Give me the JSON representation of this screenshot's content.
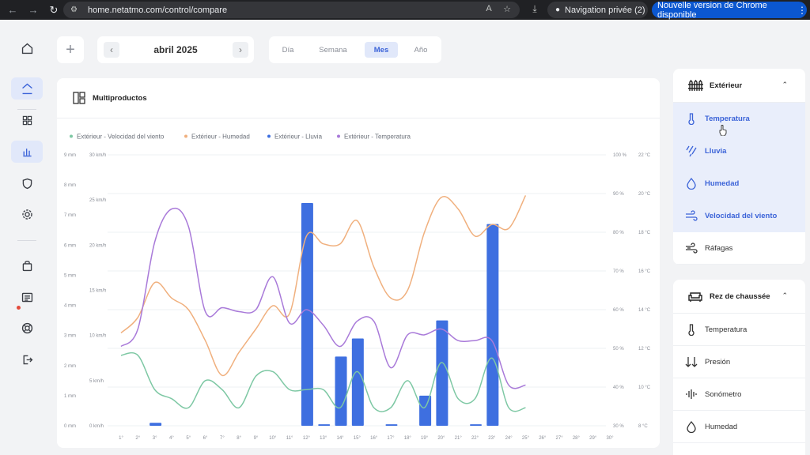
{
  "browser": {
    "url": "home.netatmo.com/control/compare",
    "private_label": "Navigation privée (2)",
    "update_label": "Nouvelle version de Chrome disponible"
  },
  "toolbar": {
    "add_label": "+",
    "month_label": "abril 2025",
    "periods": [
      {
        "label": "Día",
        "active": false
      },
      {
        "label": "Semana",
        "active": false
      },
      {
        "label": "Mes",
        "active": true
      },
      {
        "label": "Año",
        "active": false
      }
    ]
  },
  "card": {
    "title": "Multiproductos"
  },
  "right_panel": {
    "group1": {
      "title": "Extérieur",
      "items": [
        {
          "label": "Temperatura",
          "icon": "thermometer-icon",
          "selected": true
        },
        {
          "label": "Lluvia",
          "icon": "rain-icon",
          "selected": true
        },
        {
          "label": "Humedad",
          "icon": "droplet-icon",
          "selected": true
        },
        {
          "label": "Velocidad del viento",
          "icon": "wind-icon",
          "selected": true
        },
        {
          "label": "Ráfagas",
          "icon": "gust-icon",
          "selected": false
        }
      ]
    },
    "group2": {
      "title": "Rez de chaussée",
      "items": [
        {
          "label": "Temperatura",
          "icon": "thermometer-icon"
        },
        {
          "label": "Presión",
          "icon": "pressure-icon"
        },
        {
          "label": "Sonómetro",
          "icon": "sound-icon"
        },
        {
          "label": "Humedad",
          "icon": "droplet-icon"
        }
      ]
    }
  },
  "colors": {
    "wind": "#7ec8a4",
    "humidity": "#f0b07e",
    "rain": "#3e6fe0",
    "temperature": "#a97ad9",
    "accent": "#3b63d8"
  },
  "chart_data": {
    "type": "bar+line",
    "categories": [
      "1°",
      "2°",
      "3°",
      "4°",
      "5°",
      "6°",
      "7°",
      "8°",
      "9°",
      "10°",
      "11°",
      "12°",
      "13°",
      "14°",
      "15°",
      "16°",
      "17°",
      "18°",
      "19°",
      "20°",
      "21°",
      "22°",
      "23°",
      "24°",
      "25°",
      "26°",
      "27°",
      "28°",
      "29°",
      "30°"
    ],
    "axes": {
      "rain": {
        "unit": "mm",
        "min": 0,
        "max": 9,
        "ticks": [
          "0 mm",
          "1 mm",
          "2 mm",
          "3 mm",
          "4 mm",
          "5 mm",
          "6 mm",
          "7 mm",
          "8 mm",
          "9 mm"
        ]
      },
      "wind": {
        "unit": "km/h",
        "min": 0,
        "max": 30,
        "ticks": [
          "0 km/h",
          "5 km/h",
          "10 km/h",
          "15 km/h",
          "20 km/h",
          "25 km/h",
          "30 km/h"
        ]
      },
      "humidity": {
        "unit": "%",
        "min": 30,
        "max": 100,
        "ticks": [
          "30 %",
          "40 %",
          "50 %",
          "60 %",
          "70 %",
          "80 %",
          "90 %",
          "100 %"
        ]
      },
      "temperature": {
        "unit": "°C",
        "min": 8,
        "max": 22,
        "ticks": [
          "8 °C",
          "10 °C",
          "12 °C",
          "14 °C",
          "16 °C",
          "18 °C",
          "20 °C",
          "22 °C"
        ]
      }
    },
    "series": [
      {
        "name": "Extérieur - Velocidad del viento",
        "axis": "wind",
        "kind": "line",
        "values": [
          7.8,
          7.8,
          4,
          3,
          2,
          5,
          4,
          2,
          5.5,
          6,
          4,
          4,
          4,
          2,
          6,
          2,
          2,
          5,
          2,
          7,
          3,
          3,
          7.5,
          2,
          2
        ]
      },
      {
        "name": "Extérieur - Humedad",
        "axis": "humidity",
        "kind": "line",
        "values": [
          54,
          58,
          67,
          63,
          60,
          52,
          43,
          49,
          55,
          61,
          59,
          79,
          77,
          77,
          83,
          71,
          63,
          65,
          80,
          89,
          86,
          79,
          82,
          81,
          89.5
        ]
      },
      {
        "name": "Extérieur - Lluvia",
        "axis": "rain",
        "kind": "bar",
        "values": [
          0,
          0,
          0.1,
          0,
          0,
          0,
          0,
          0,
          0,
          0,
          0,
          7.4,
          0.05,
          2.3,
          2.9,
          0,
          0.05,
          0,
          1,
          3.5,
          0,
          0.05,
          6.7,
          0,
          0,
          0,
          0,
          0,
          0,
          0
        ]
      },
      {
        "name": "Extérieur - Temperatura",
        "axis": "temperature",
        "kind": "line",
        "values": [
          12.1,
          13,
          17.5,
          19.2,
          18.3,
          13.9,
          14.1,
          13.9,
          14,
          15.7,
          13.3,
          14,
          13.2,
          12.1,
          13.4,
          13.4,
          11,
          12.7,
          12.7,
          13,
          12.4,
          12.4,
          12.4,
          10.1,
          10.1
        ]
      }
    ],
    "grid": true,
    "legend": "top-left"
  }
}
